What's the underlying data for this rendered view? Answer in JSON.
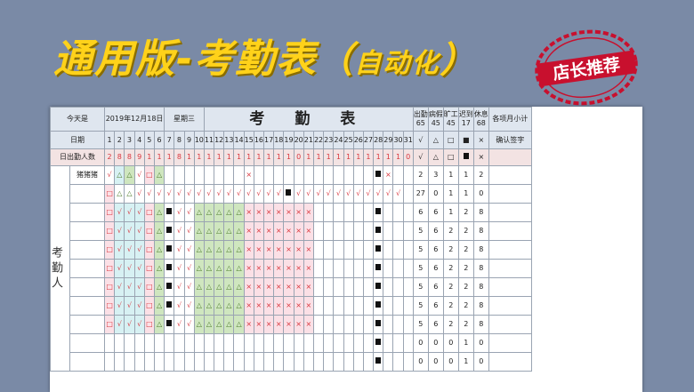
{
  "banner": {
    "main": "通用版-考勤表",
    "open_paren": "（",
    "sub": "自动化",
    "close_paren": "）"
  },
  "stamp": {
    "text": "店长推荐"
  },
  "sheet": {
    "today_label": "今天是",
    "date_value": "2019年12月18日",
    "weekday_value": "星期三",
    "title": "考 勤 表",
    "header_summary": [
      "出勤",
      "65",
      "病假",
      "45",
      "旷工",
      "45",
      "迟到",
      "17",
      "休息",
      "68",
      "各项月小计"
    ],
    "date_row_label": "日期",
    "days": [
      "1",
      "2",
      "3",
      "4",
      "5",
      "6",
      "7",
      "8",
      "9",
      "10",
      "11",
      "12",
      "13",
      "14",
      "15",
      "16",
      "17",
      "18",
      "19",
      "20",
      "21",
      "22",
      "23",
      "24",
      "25",
      "26",
      "27",
      "28",
      "29",
      "30",
      "31"
    ],
    "summary_symbols": [
      "√",
      "△",
      "□",
      "■",
      "×"
    ],
    "confirm_label": "确认签字",
    "count_row_label": "日出勤人数",
    "counts": [
      "2",
      "8",
      "8",
      "9",
      "1",
      "1",
      "1",
      "8",
      "1",
      "1",
      "1",
      "1",
      "1",
      "1",
      "1",
      "1",
      "1",
      "1",
      "1",
      "0",
      "1",
      "1",
      "1",
      "1",
      "1",
      "1",
      "1",
      "1",
      "1",
      "1",
      "0"
    ],
    "side_label": "考勤人",
    "employees": [
      {
        "name": "猪猪猪",
        "totals": [
          "2",
          "3",
          "1",
          "1",
          "2"
        ]
      },
      {
        "name": "",
        "totals": [
          "27",
          "0",
          "1",
          "1",
          "0"
        ]
      },
      {
        "name": "",
        "totals": [
          "6",
          "6",
          "1",
          "2",
          "8"
        ]
      },
      {
        "name": "",
        "totals": [
          "5",
          "6",
          "2",
          "2",
          "8"
        ]
      },
      {
        "name": "",
        "totals": [
          "5",
          "6",
          "2",
          "2",
          "8"
        ]
      },
      {
        "name": "",
        "totals": [
          "5",
          "6",
          "2",
          "2",
          "8"
        ]
      },
      {
        "name": "",
        "totals": [
          "5",
          "6",
          "2",
          "2",
          "8"
        ]
      },
      {
        "name": "",
        "totals": [
          "5",
          "6",
          "2",
          "2",
          "8"
        ]
      },
      {
        "name": "",
        "totals": [
          "5",
          "6",
          "2",
          "2",
          "8"
        ]
      },
      {
        "name": "",
        "totals": [
          "0",
          "0",
          "0",
          "1",
          "0"
        ]
      },
      {
        "name": "",
        "totals": [
          "0",
          "0",
          "0",
          "1",
          "0"
        ]
      }
    ]
  }
}
